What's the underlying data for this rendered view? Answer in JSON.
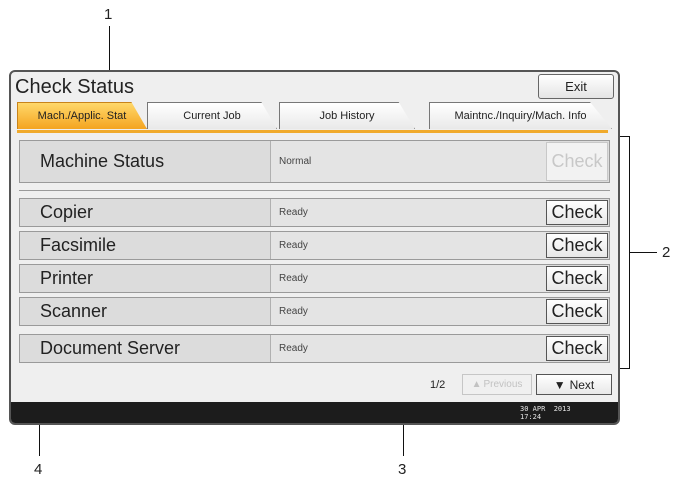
{
  "callouts": [
    "1",
    "2",
    "3",
    "4"
  ],
  "window": {
    "title": "Check Status",
    "exit_label": "Exit"
  },
  "tabs": [
    {
      "label": "Mach./Applic. Stat",
      "active": true
    },
    {
      "label": "Current Job",
      "active": false
    },
    {
      "label": "Job History",
      "active": false
    },
    {
      "label": "Maintnc./Inquiry/Mach. Info",
      "active": false
    }
  ],
  "rows": [
    {
      "name": "Machine Status",
      "status": "Normal",
      "check_label": "Check",
      "check_enabled": false
    },
    {
      "name": "Copier",
      "status": "Ready",
      "check_label": "Check",
      "check_enabled": true
    },
    {
      "name": "Facsimile",
      "status": "Ready",
      "check_label": "Check",
      "check_enabled": true
    },
    {
      "name": "Printer",
      "status": "Ready",
      "check_label": "Check",
      "check_enabled": true
    },
    {
      "name": "Scanner",
      "status": "Ready",
      "check_label": "Check",
      "check_enabled": true
    },
    {
      "name": "Document Server",
      "status": "Ready",
      "check_label": "Check",
      "check_enabled": true
    }
  ],
  "pager": {
    "page": "1/2",
    "previous_label": "Previous",
    "next_label": "Next",
    "previous_icon": "triangle-up-icon",
    "next_icon": "triangle-down-icon"
  },
  "status_bar": {
    "date": "30 APR  2013",
    "time": "17:24"
  },
  "colors": {
    "active_tab": "#f4a420",
    "footer": "#1c1c1c",
    "callout_line": "#111111"
  }
}
